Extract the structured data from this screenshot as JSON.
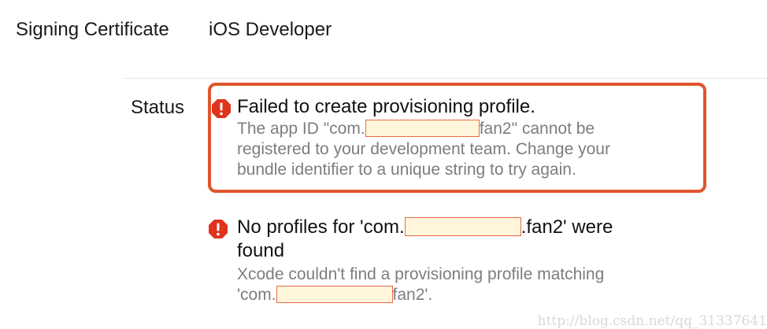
{
  "signing": {
    "label": "Signing Certificate",
    "value": "iOS Developer"
  },
  "status": {
    "label": "Status"
  },
  "errors": [
    {
      "title": "Failed to create provisioning profile.",
      "body_line1_pre": "The app ID \"com.",
      "body_line1_post": "fan2\" cannot be",
      "body_line2": "registered to your development team. Change your",
      "body_line3": "bundle identifier to a unique string to try again."
    },
    {
      "title_pre": "No profiles for 'com.",
      "title_post": ".fan2' were",
      "title_line2": "found",
      "body_line1": "Xcode couldn't find a provisioning profile matching",
      "body_line2_pre": "'com.",
      "body_line2_post": "fan2'."
    }
  ],
  "colors": {
    "error_icon": "#e0331c",
    "highlight_border": "#e1552c",
    "redaction_fill": "#fff6dc"
  },
  "icons": {
    "error": "exclamation-octagon-icon"
  },
  "watermark": "http://blog.csdn.net/qq_31337641"
}
